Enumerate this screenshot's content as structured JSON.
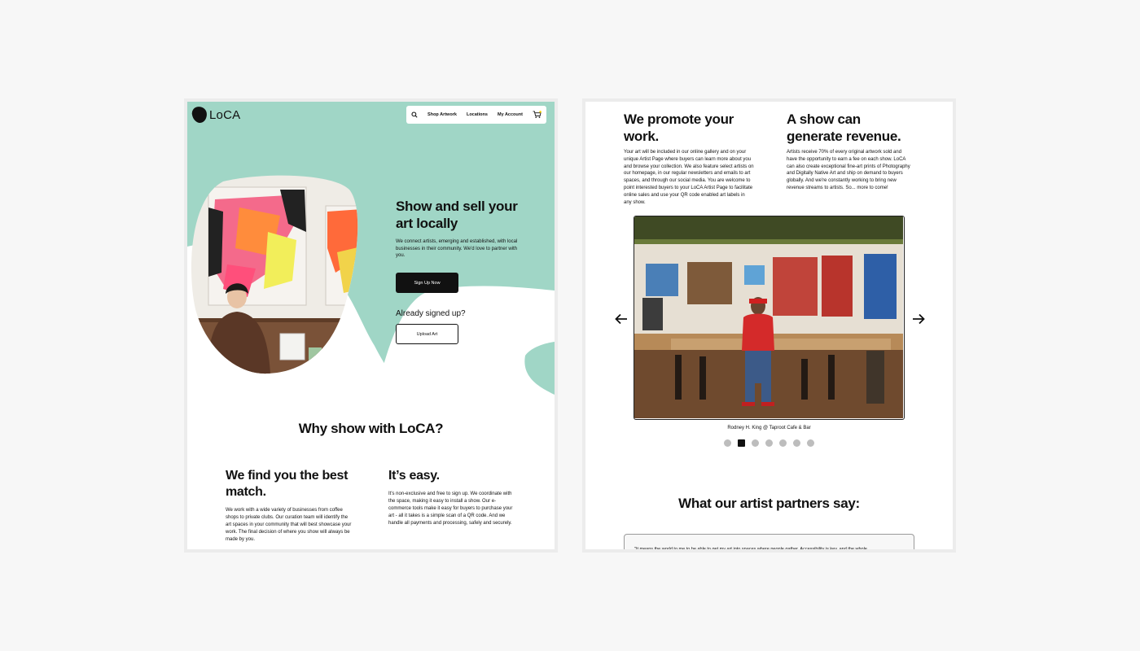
{
  "left": {
    "brand": "LoCA",
    "nav": {
      "shop": "Shop Artwork",
      "locations": "Locations",
      "account": "My Account"
    },
    "hero": {
      "title": "Show and sell your art locally",
      "subtitle": "We connect artists, emerging and established, with local businesses in their community. We'd love to partner with you.",
      "signup_label": "Sign Up Now",
      "already_label": "Already signed up?",
      "upload_label": "Upload Art"
    },
    "why_title": "Why show with LoCA?",
    "match": {
      "title": "We find you the best match.",
      "text": "We work with a wide variety of businesses from coffee shops to private clubs. Our curation team will identify the art spaces in your community that will best showcase your work. The final decision of where you show will always be made by you."
    },
    "easy": {
      "title": "It’s easy.",
      "text": "It's non-exclusive and free to sign up. We coordinate with the space, making it easy to install a show. Our e-commerce tools make it easy for buyers to purchase your art - all it takes is a simple scan of a QR code. And we handle all payments and processing, safely and securely."
    }
  },
  "right": {
    "promote": {
      "title": "We promote your work.",
      "text": "Your art will be included in our online gallery and on your unique Artist Page where buyers can learn more about you and browse your collection. We also feature select artists on our homepage, in our regular newsletters and emails to art spaces, and through our social media. You are welcome to point interested buyers to your LoCA Artist Page to facilitate online sales and use your QR code enabled art labels in any show."
    },
    "revenue": {
      "title": "A show can generate revenue.",
      "text": "Artists receive 70% of every original artwork sold and have the opportunity to earn a fee on each show. LoCA can also create exceptional fine-art prints of Photography and Digitally Native Art and ship on demand to buyers globally. And we're constantly working to bring new revenue streams to artists. So... more to come!"
    },
    "carousel": {
      "caption": "Rodney H. King @ Taproot Cafe & Bar",
      "active_index": 1,
      "total": 7
    },
    "testimonials_title": "What our artist partners say:",
    "quote": "\"It means the world to me to be able to get my art into spaces where people gather. Accessibility is key, and the whole"
  },
  "colors": {
    "mint": "#a0d6c6",
    "black": "#111111",
    "page_bg": "#f7f7f7"
  }
}
